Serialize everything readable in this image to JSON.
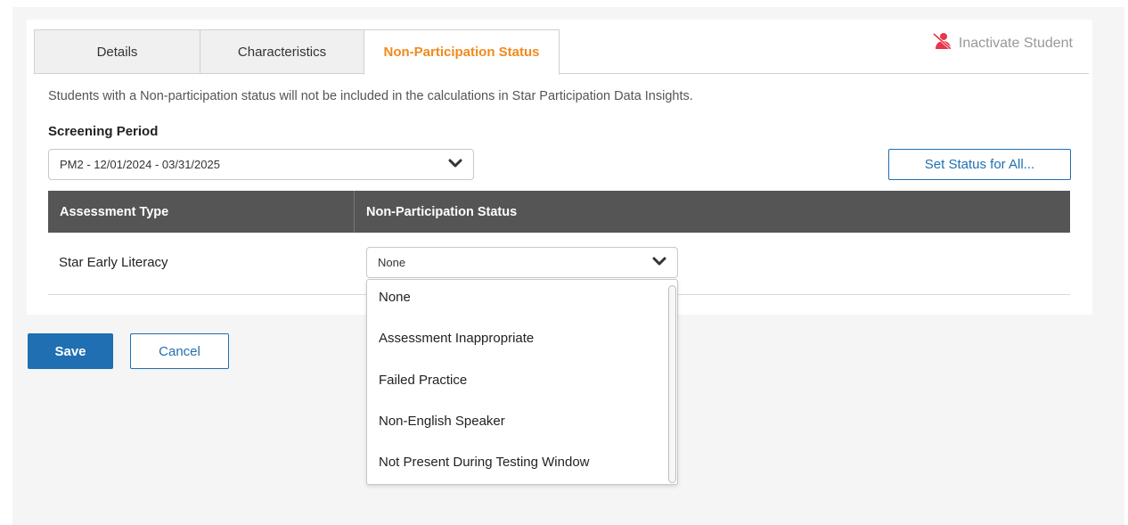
{
  "tabs": [
    {
      "label": "Details",
      "active": false
    },
    {
      "label": "Characteristics",
      "active": false
    },
    {
      "label": "Non-Participation Status",
      "active": true
    }
  ],
  "inactivate": {
    "label": "Inactivate Student",
    "icon": "inactivate-user-icon",
    "icon_color": "#e8364a"
  },
  "info_text": "Students with a Non-participation status will not be included in the calculations in Star Participation Data Insights.",
  "screening": {
    "label": "Screening Period",
    "selected": "PM2 - 12/01/2024 - 03/31/2025"
  },
  "set_status_all_label": "Set Status for All...",
  "table": {
    "headers": [
      "Assessment Type",
      "Non-Participation Status"
    ],
    "rows": [
      {
        "assessment": "Star Early Literacy",
        "status": "None"
      }
    ]
  },
  "status_options": [
    "None",
    "Assessment Inappropriate",
    "Failed Practice",
    "Non-English Speaker",
    "Not Present During Testing Window"
  ],
  "actions": {
    "save_label": "Save",
    "cancel_label": "Cancel"
  },
  "colors": {
    "accent": "#1f6fb2",
    "active_tab": "#f08a1e",
    "header_bg": "#555555"
  }
}
